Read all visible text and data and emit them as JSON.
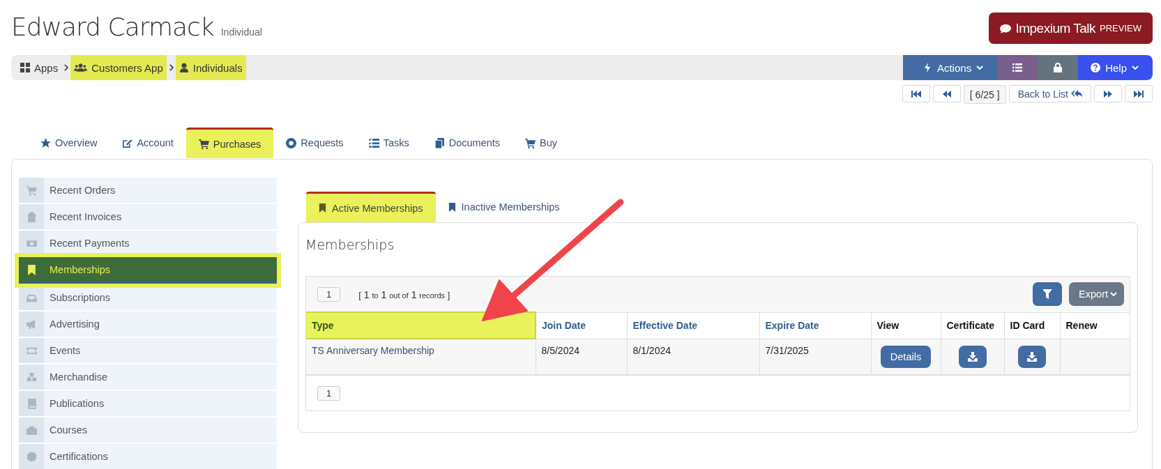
{
  "header": {
    "name": "Edward Carmack",
    "type": "Individual",
    "talk_button": {
      "label": "Impexium Talk",
      "badge": "PREVIEW"
    }
  },
  "breadcrumb": [
    {
      "label": "Apps",
      "highlighted": false
    },
    {
      "label": "Customers App",
      "highlighted": true
    },
    {
      "label": "Individuals",
      "highlighted": true
    }
  ],
  "toolbar": [
    {
      "kind": "actions",
      "label": "Actions"
    },
    {
      "kind": "list"
    },
    {
      "kind": "lock"
    },
    {
      "kind": "help",
      "label": "Help"
    }
  ],
  "pager": {
    "position": "[ 6/25 ]",
    "back": "Back to List"
  },
  "tabs": [
    {
      "label": "Overview",
      "selected": false
    },
    {
      "label": "Account",
      "selected": false
    },
    {
      "label": "Purchases",
      "selected": true
    },
    {
      "label": "Requests",
      "selected": false
    },
    {
      "label": "Tasks",
      "selected": false
    },
    {
      "label": "Documents",
      "selected": false
    },
    {
      "label": "Buy",
      "selected": false
    }
  ],
  "sidebar": {
    "items": [
      {
        "label": "Recent Orders",
        "selected": false
      },
      {
        "label": "Recent Invoices",
        "selected": false
      },
      {
        "label": "Recent Payments",
        "selected": false
      },
      {
        "label": "Memberships",
        "selected": true
      },
      {
        "label": "Subscriptions",
        "selected": false
      },
      {
        "label": "Advertising",
        "selected": false
      },
      {
        "label": "Events",
        "selected": false
      },
      {
        "label": "Merchandise",
        "selected": false
      },
      {
        "label": "Publications",
        "selected": false
      },
      {
        "label": "Courses",
        "selected": false
      },
      {
        "label": "Certifications",
        "selected": false
      }
    ]
  },
  "subtabs": [
    {
      "label": "Active Memberships",
      "selected": true
    },
    {
      "label": "Inactive Memberships",
      "selected": false
    }
  ],
  "panel": {
    "title": "Memberships",
    "page_size": "1",
    "range": {
      "open": "[",
      "from": "1",
      "to_word": "to",
      "to": "1",
      "of_word": "out of",
      "total": "1",
      "records_word": "records",
      "close": "]"
    },
    "export_label": "Export",
    "table": {
      "columns": [
        {
          "label": "Type",
          "sortable": true,
          "highlighted": true
        },
        {
          "label": "Join Date",
          "sortable": true,
          "highlighted": false
        },
        {
          "label": "Effective Date",
          "sortable": true,
          "highlighted": false
        },
        {
          "label": "Expire Date",
          "sortable": true,
          "highlighted": false
        },
        {
          "label": "View",
          "sortable": false,
          "highlighted": false
        },
        {
          "label": "Certificate",
          "sortable": false,
          "highlighted": false
        },
        {
          "label": "ID Card",
          "sortable": false,
          "highlighted": false
        },
        {
          "label": "Renew",
          "sortable": false,
          "highlighted": false
        }
      ],
      "rows": [
        {
          "type": "TS Anniversary Membership",
          "join_date": "8/5/2024",
          "effective_date": "8/1/2024",
          "expire_date": "7/31/2025",
          "view": "Details"
        }
      ]
    },
    "footer_page": "1"
  },
  "annotation": {
    "kind": "arrow"
  }
}
